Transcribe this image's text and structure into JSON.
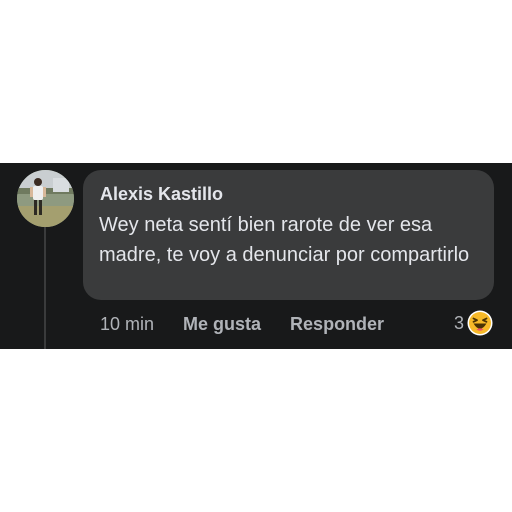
{
  "comment": {
    "author": "Alexis Kastillo",
    "text": "Wey neta sentí bien rarote de ver esa madre, te voy a denunciar por compartirlo",
    "timestamp": "10 min",
    "like_label": "Me gusta",
    "reply_label": "Responder",
    "reaction_count": "3",
    "reaction_icon": "haha-emoji-icon"
  },
  "colors": {
    "panel_background": "#18191a",
    "bubble_background": "#3a3b3c",
    "primary_text": "#e4e6eb",
    "secondary_text": "#b0b3b8",
    "reaction_yellow": "#f7b928"
  }
}
